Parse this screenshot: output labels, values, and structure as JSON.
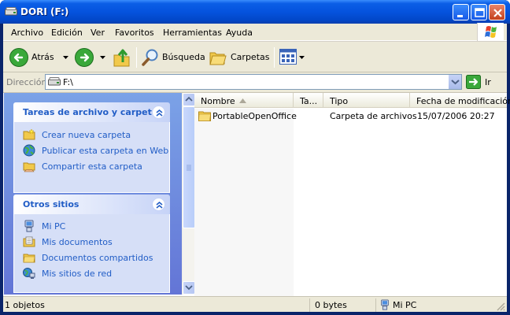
{
  "window": {
    "title": "DORI (F:)"
  },
  "menu": [
    "Archivo",
    "Edición",
    "Ver",
    "Favoritos",
    "Herramientas",
    "Ayuda"
  ],
  "toolbar": {
    "back": "Atrás",
    "search": "Búsqueda",
    "folders": "Carpetas"
  },
  "address": {
    "label": "Dirección",
    "value": "F:\\",
    "go": "Ir"
  },
  "tasks_panel": {
    "title": "Tareas de archivo y carpeta",
    "items": [
      "Crear nueva carpeta",
      "Publicar esta carpeta en Web",
      "Compartir esta carpeta"
    ]
  },
  "places_panel": {
    "title": "Otros sitios",
    "items": [
      "Mi PC",
      "Mis documentos",
      "Documentos compartidos",
      "Mis sitios de red"
    ]
  },
  "columns": [
    "Nombre",
    "Ta...",
    "Tipo",
    "Fecha de modificación"
  ],
  "files": [
    {
      "name": "PortableOpenOffice",
      "size": "",
      "type": "Carpeta de archivos",
      "modified": "15/07/2006 20:27"
    }
  ],
  "status": {
    "count": "1 objetos",
    "size": "0 bytes",
    "location": "Mi PC"
  },
  "colors": {
    "title_bar": "#0553de",
    "task_link": "#215dc6",
    "pane_gradient_top": "#7ba2e7",
    "pane_gradient_bottom": "#6375d6",
    "close_button": "#c3401c"
  }
}
